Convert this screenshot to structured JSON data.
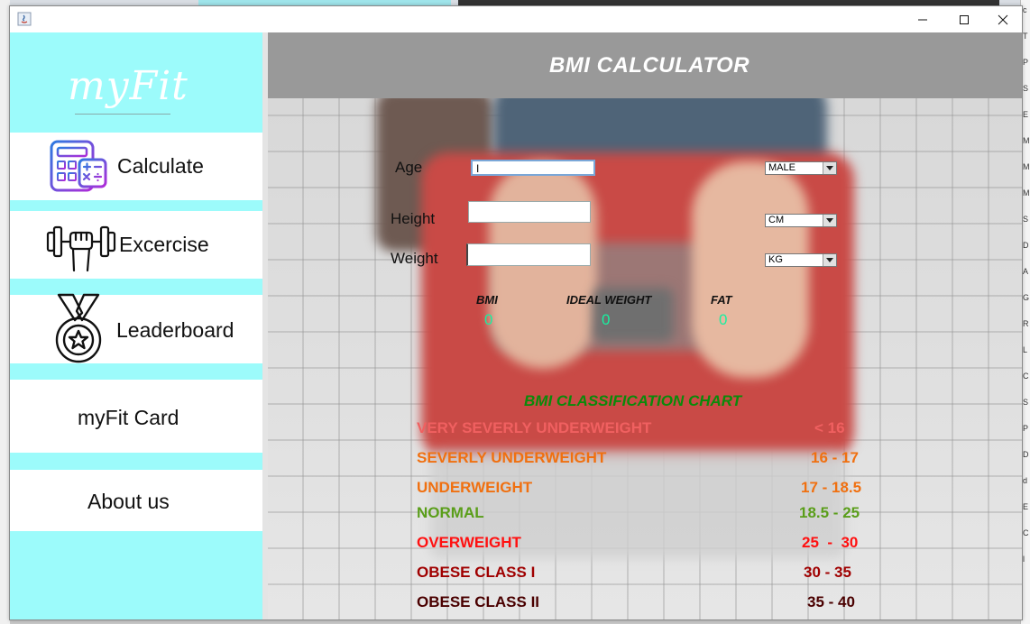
{
  "app": {
    "logo_text": "myFit"
  },
  "sidebar": {
    "items": [
      {
        "label": "Calculate",
        "icon": "calculator-icon"
      },
      {
        "label": "Excercise",
        "icon": "dumbbell-icon"
      },
      {
        "label": "Leaderboard",
        "icon": "medal-icon"
      },
      {
        "label": "myFit Card"
      },
      {
        "label": "About us"
      }
    ]
  },
  "header": {
    "title": "BMI CALCULATOR"
  },
  "form": {
    "age_label": "Age",
    "age_value": "I",
    "height_label": "Height",
    "height_value": "",
    "weight_label": "Weight",
    "weight_value": "",
    "gender_selected": "MALE",
    "height_unit_selected": "CM",
    "weight_unit_selected": "KG"
  },
  "results": {
    "bmi_label": "BMI",
    "bmi_value": "0",
    "ideal_weight_label": "IDEAL WEIGHT",
    "ideal_weight_value": "0",
    "fat_label": "FAT",
    "fat_value": "0"
  },
  "classification": {
    "title": "BMI CLASSIFICATION CHART",
    "rows": [
      {
        "name": "VERY SEVERLY UNDERWEIGHT",
        "range": "< 16",
        "color": "#f06060"
      },
      {
        "name": "SEVERLY UNDERWEIGHT",
        "range": "16 - 17",
        "color": "#f07010"
      },
      {
        "name": "UNDERWEIGHT",
        "range": "17 - 18.5",
        "color": "#f07010"
      },
      {
        "name": "NORMAL",
        "range": "18.5 - 25",
        "color": "#5a9e1a"
      },
      {
        "name": "OVERWEIGHT",
        "range": "25  -  30",
        "color": "#ff1010"
      },
      {
        "name": "OBESE CLASS I",
        "range": "30 - 35",
        "color": "#a00000"
      },
      {
        "name": "OBESE CLASS II",
        "range": "35 - 40",
        "color": "#4a0000"
      }
    ]
  },
  "colors": {
    "sidebar": "#9cfbfb",
    "header": "#999999",
    "result_value": "#18f0a0",
    "chart_title": "#0a8a0a"
  }
}
